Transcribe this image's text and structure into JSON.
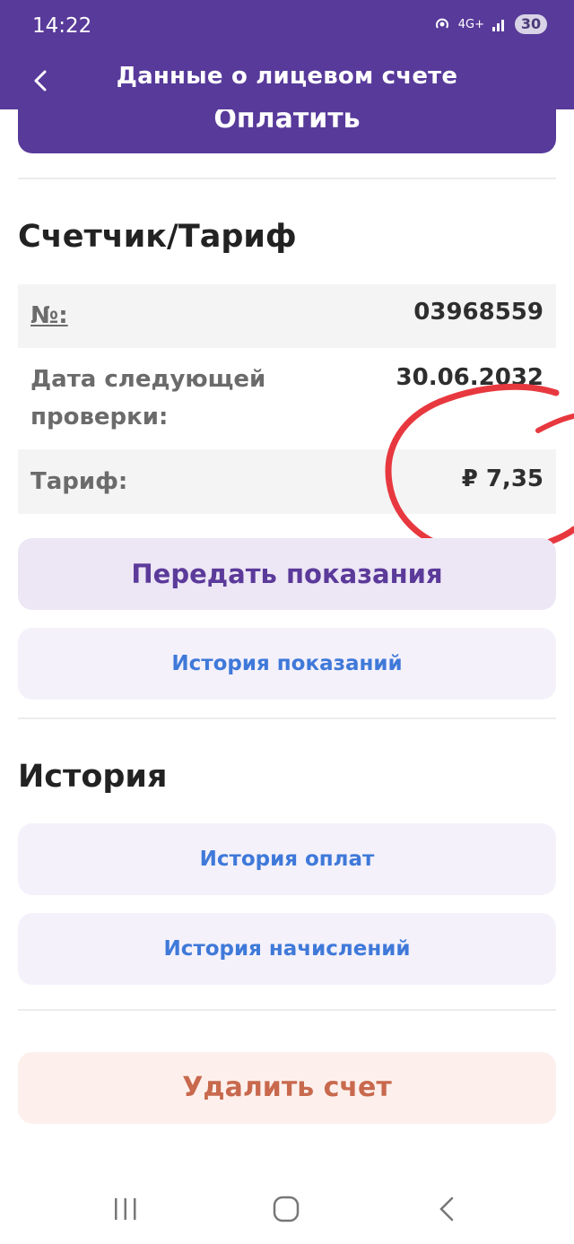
{
  "status_bar": {
    "time": "14:22",
    "network": "4G+",
    "battery": "30"
  },
  "header": {
    "title": "Данные о лицевом счете"
  },
  "actions": {
    "pay_label": "Оплатить"
  },
  "meter_section": {
    "title": "Счетчик/Тариф",
    "rows": [
      {
        "label": "№:",
        "value": "03968559"
      },
      {
        "label": "Дата следующей проверки:",
        "value": "30.06.2032"
      },
      {
        "label": "Тариф:",
        "value": "₽ 7,35"
      }
    ],
    "submit_button": "Передать показания",
    "readings_history_button": "История показаний"
  },
  "history_section": {
    "title": "История",
    "payments_button": "История оплат",
    "charges_button": "История начислений"
  },
  "delete_button": "Удалить счет",
  "colors": {
    "brand": "#583a9a",
    "link": "#3f79d9",
    "danger": "#c8694e",
    "annotation": "#e8383f"
  }
}
